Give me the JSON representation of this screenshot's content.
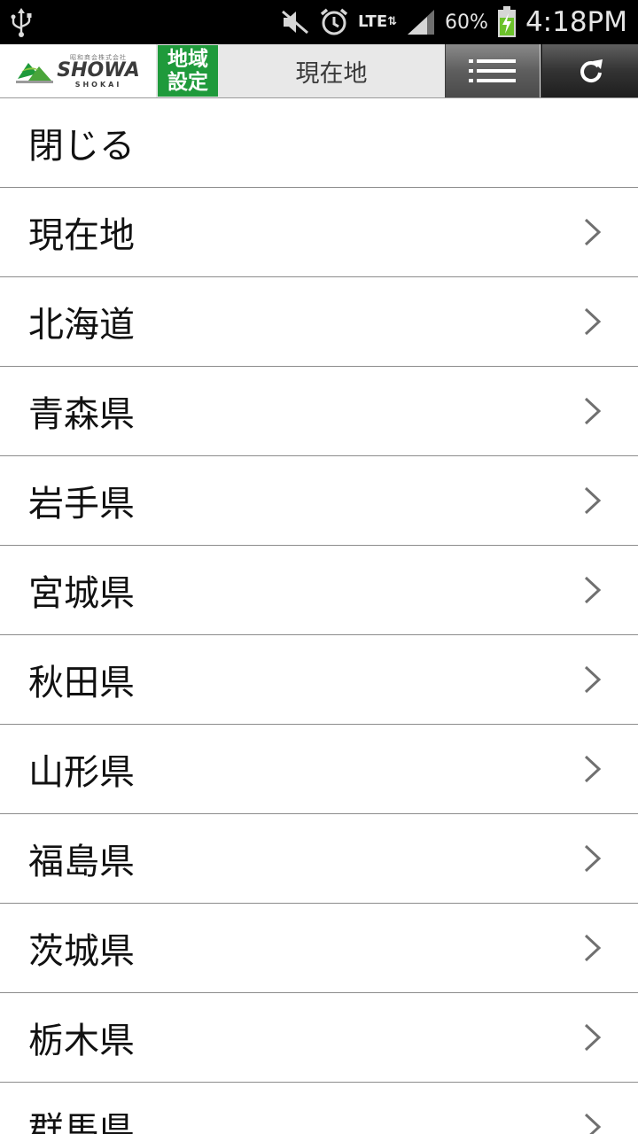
{
  "status_bar": {
    "icons": [
      "usb-icon",
      "mute-icon",
      "alarm-icon",
      "lte-icon",
      "signal-icon",
      "battery-charging-icon"
    ],
    "network": "LTE",
    "battery_percent": "60%",
    "time": "4:18PM"
  },
  "header": {
    "logo": {
      "top_text": "昭和商会株式会社",
      "main_text": "SHOWA",
      "sub_text": "SHOKAI",
      "brand_color": "#1f9a3b"
    },
    "region_button": {
      "line1": "地域",
      "line2": "設定"
    },
    "title": "現在地",
    "menu_icon": "list-menu-icon",
    "refresh_icon": "refresh-icon"
  },
  "menu": {
    "close_label": "閉じる",
    "items": [
      {
        "label": "現在地"
      },
      {
        "label": "北海道"
      },
      {
        "label": "青森県"
      },
      {
        "label": "岩手県"
      },
      {
        "label": "宮城県"
      },
      {
        "label": "秋田県"
      },
      {
        "label": "山形県"
      },
      {
        "label": "福島県"
      },
      {
        "label": "茨城県"
      },
      {
        "label": "栃木県"
      },
      {
        "label": "群馬県"
      }
    ]
  }
}
